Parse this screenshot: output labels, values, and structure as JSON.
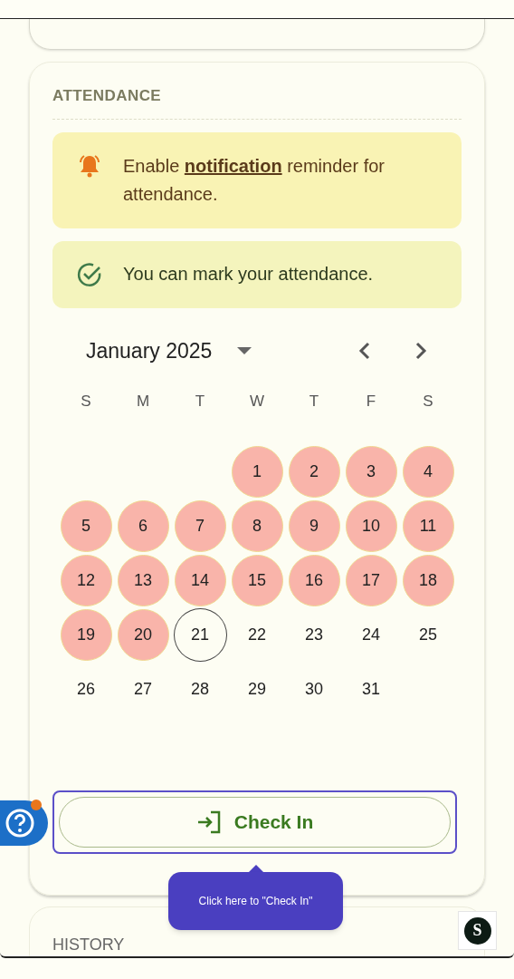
{
  "section_title": "ATTENDANCE",
  "alerts": [
    {
      "kind": "warning",
      "text": "Enable **notification** reminder for attendance."
    },
    {
      "kind": "success",
      "text": "You can mark your attendance."
    }
  ],
  "calendar": {
    "month": "January 2025",
    "weekdays": [
      "S",
      "M",
      "T",
      "W",
      "T",
      "F",
      "S"
    ],
    "weeks": [
      [
        {
          "day": "1",
          "marked": true,
          "today": false
        },
        {
          "day": "2",
          "marked": true,
          "today": false
        },
        {
          "day": "3",
          "marked": true,
          "today": false
        },
        {
          "day": "4",
          "marked": true,
          "today": false
        }
      ],
      [
        {
          "day": "5",
          "marked": true,
          "today": false
        },
        {
          "day": "6",
          "marked": true,
          "today": false
        },
        {
          "day": "7",
          "marked": true,
          "today": false
        },
        {
          "day": "8",
          "marked": true,
          "today": false
        },
        {
          "day": "9",
          "marked": true,
          "today": false
        },
        {
          "day": "10",
          "marked": true,
          "today": false
        },
        {
          "day": "11",
          "marked": true,
          "today": false
        }
      ],
      [
        {
          "day": "12",
          "marked": true,
          "today": false
        },
        {
          "day": "13",
          "marked": true,
          "today": false
        },
        {
          "day": "14",
          "marked": true,
          "today": false
        },
        {
          "day": "15",
          "marked": true,
          "today": false
        },
        {
          "day": "16",
          "marked": true,
          "today": false
        },
        {
          "day": "17",
          "marked": true,
          "today": false
        },
        {
          "day": "18",
          "marked": true,
          "today": false
        }
      ],
      [
        {
          "day": "19",
          "marked": true,
          "today": false
        },
        {
          "day": "20",
          "marked": true,
          "today": false
        },
        {
          "day": "21",
          "marked": false,
          "today": true
        },
        {
          "day": "22",
          "marked": false,
          "today": false
        },
        {
          "day": "23",
          "marked": false,
          "today": false
        },
        {
          "day": "24",
          "marked": false,
          "today": false
        },
        {
          "day": "25",
          "marked": false,
          "today": false
        }
      ],
      [
        {
          "day": "26",
          "marked": false,
          "today": false
        },
        {
          "day": "27",
          "marked": false,
          "today": false
        },
        {
          "day": "28",
          "marked": false,
          "today": false
        },
        {
          "day": "29",
          "marked": false,
          "today": false
        },
        {
          "day": "30",
          "marked": false,
          "today": false
        },
        {
          "day": "31",
          "marked": false,
          "today": false
        }
      ]
    ]
  },
  "check_in_button": {
    "label": "Check In"
  },
  "tooltip": {
    "text": "Click here to \"Check In\""
  },
  "next_section_title": "HISTORY",
  "avatar": {
    "initial": "S"
  }
}
